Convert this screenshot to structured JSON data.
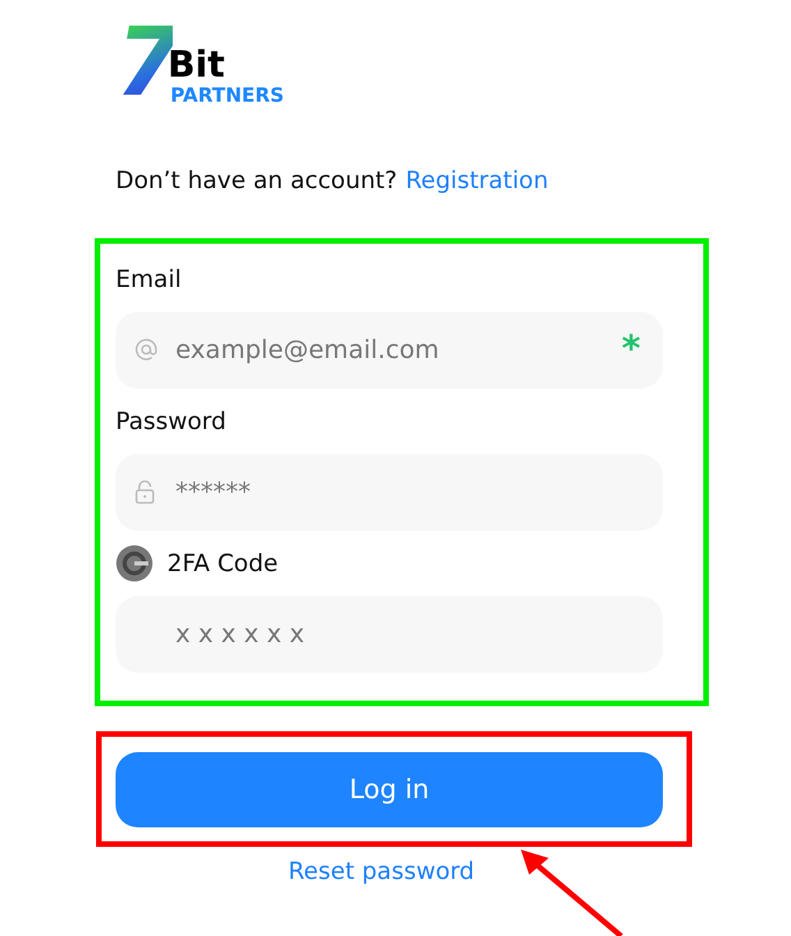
{
  "logo": {
    "mark": "7",
    "word": "Bit",
    "sub": "PARTNERS"
  },
  "signup_prompt": {
    "text": "Don’t have an account?",
    "link": "Registration"
  },
  "fields": [
    {
      "kind": "email",
      "label": "Email",
      "placeholder": "example@email.com",
      "required_mark": "*"
    },
    {
      "kind": "password",
      "label": "Password",
      "placeholder": "******"
    },
    {
      "kind": "code",
      "label": "2FA Code",
      "placeholder": "x x x x x x"
    }
  ],
  "login_button": "Log in",
  "reset_link": "Reset password",
  "fields_frame": {
    "color": "#00ee00"
  },
  "button_frame": {
    "color": "#ff0000"
  },
  "pointer_arrow": {
    "color": "#ff0000"
  }
}
